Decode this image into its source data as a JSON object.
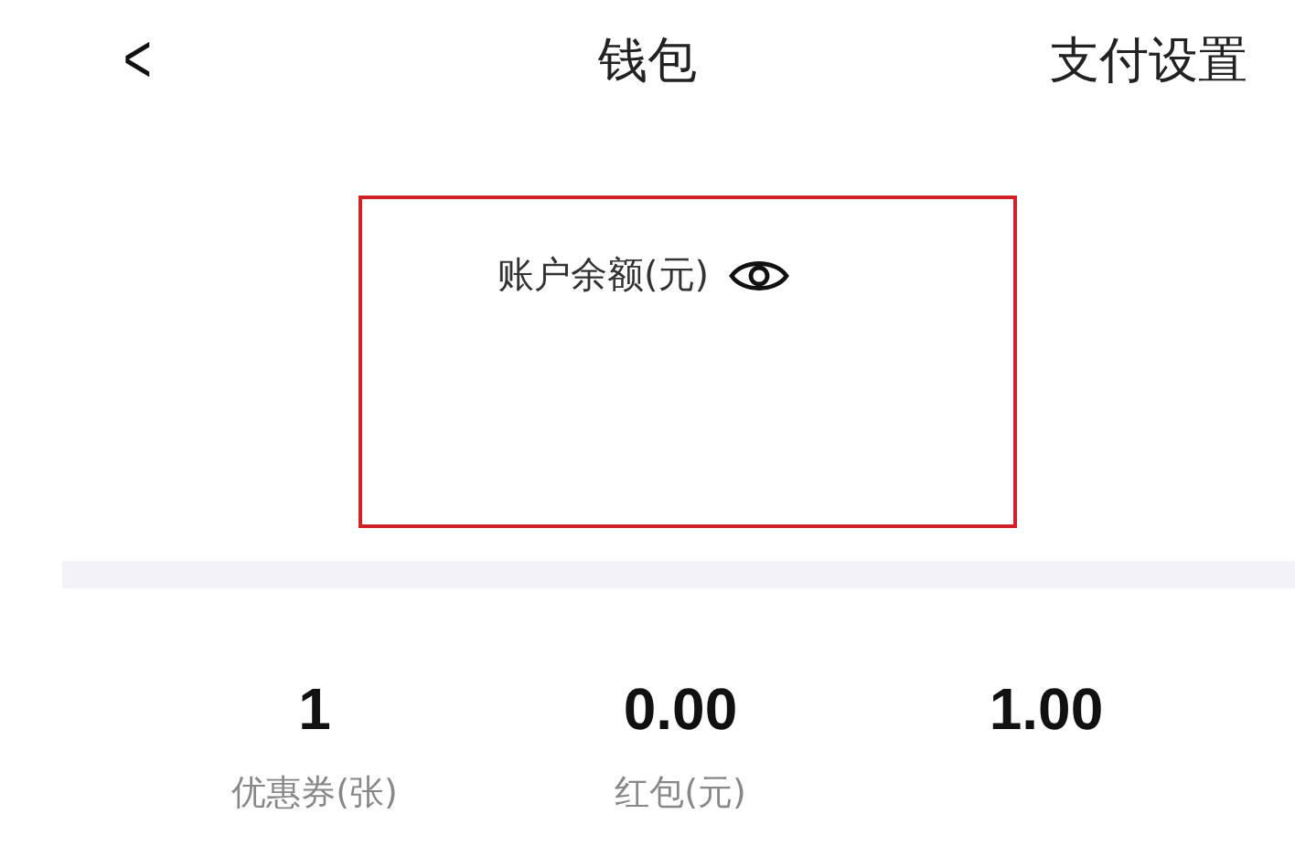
{
  "header": {
    "back": "<",
    "title": "钱包",
    "action": "支付设置"
  },
  "balance": {
    "label": "账户余额(元)"
  },
  "stats": [
    {
      "value": "1",
      "label": "优惠券(张)"
    },
    {
      "value": "0.00",
      "label": "红包(元)"
    },
    {
      "value": "1.00"
    }
  ]
}
